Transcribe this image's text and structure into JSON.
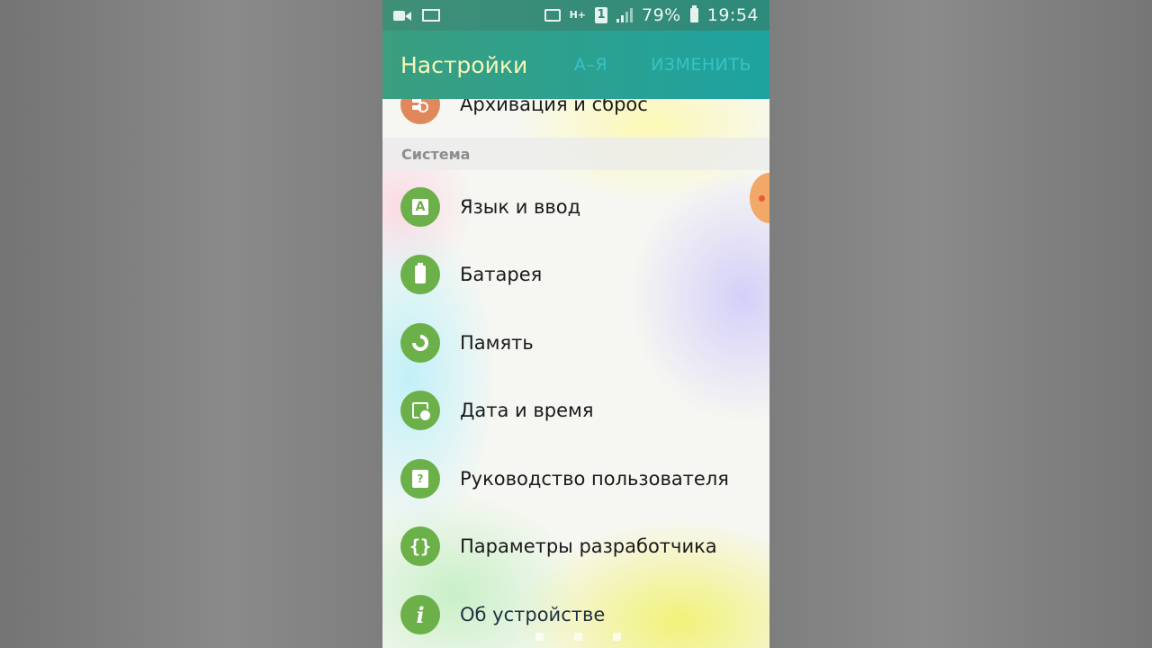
{
  "status_bar": {
    "left_icons": [
      "video-camera-icon",
      "email-icon"
    ],
    "network_type": "H+",
    "sim_slot": "1",
    "battery_percent": "79%",
    "time": "19:54"
  },
  "app_bar": {
    "title": "Настройки",
    "sort_label": "А–Я",
    "edit_label": "ИЗМЕНИТЬ"
  },
  "partial_item": {
    "label": "Архивация и сброс",
    "icon": "backup-icon"
  },
  "section": {
    "title": "Система"
  },
  "items": [
    {
      "label": "Язык и ввод",
      "icon": "language-icon"
    },
    {
      "label": "Батарея",
      "icon": "battery-icon"
    },
    {
      "label": "Память",
      "icon": "storage-icon"
    },
    {
      "label": "Дата и время",
      "icon": "calendar-clock-icon"
    },
    {
      "label": "Руководство пользователя",
      "icon": "user-manual-icon"
    },
    {
      "label": "Параметры разработчика",
      "icon": "developer-braces-icon"
    },
    {
      "label": "Об устройстве",
      "icon": "info-icon"
    }
  ],
  "colors": {
    "appbar_green": "#3a9e7f",
    "appbar_teal": "#1ea3a0",
    "icon_green": "#6cb04a",
    "title_yellow": "#f7f7b8",
    "action_cyan": "#37c2c6"
  }
}
